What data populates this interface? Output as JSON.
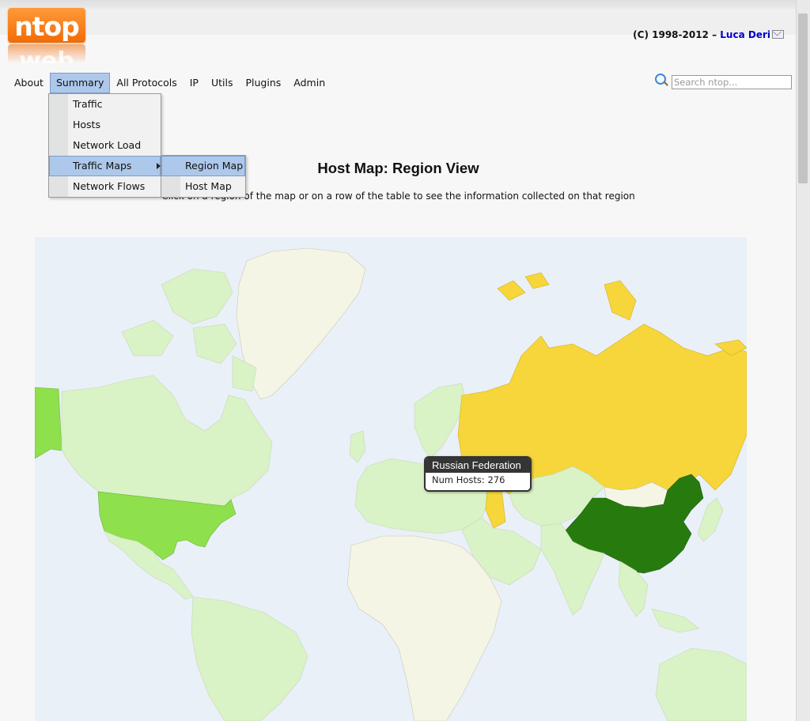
{
  "header": {
    "logo_text": "ntop",
    "logo_reflection": "web",
    "copyright": "(C) 1998-2012 –",
    "author": "Luca Deri"
  },
  "nav": {
    "items": [
      {
        "label": "About",
        "active": false
      },
      {
        "label": "Summary",
        "active": true
      },
      {
        "label": "All Protocols",
        "active": false
      },
      {
        "label": "IP",
        "active": false
      },
      {
        "label": "Utils",
        "active": false
      },
      {
        "label": "Plugins",
        "active": false
      },
      {
        "label": "Admin",
        "active": false
      }
    ]
  },
  "search": {
    "placeholder": "Search ntop..."
  },
  "summary_menu": {
    "items": [
      "Traffic",
      "Hosts",
      "Network Load",
      "Traffic Maps",
      "Network Flows"
    ],
    "active": "Traffic Maps"
  },
  "traffic_maps_menu": {
    "items": [
      "Region Map",
      "Host Map"
    ],
    "active": "Region Map"
  },
  "page": {
    "title": "Host Map: Region View",
    "subtitle": "Click on a region of the map or on a row of the table to see the information collected on that region"
  },
  "map": {
    "colors": {
      "ocean": "#eaf0f8",
      "no_data": "#f5f5e6",
      "low": "#d9f2c6",
      "united_states": "#8ee04c",
      "russia": "#f6d63a",
      "china": "#277b0e"
    },
    "tooltip": {
      "region": "Russian Federation",
      "info": "Num Hosts: 276"
    }
  }
}
